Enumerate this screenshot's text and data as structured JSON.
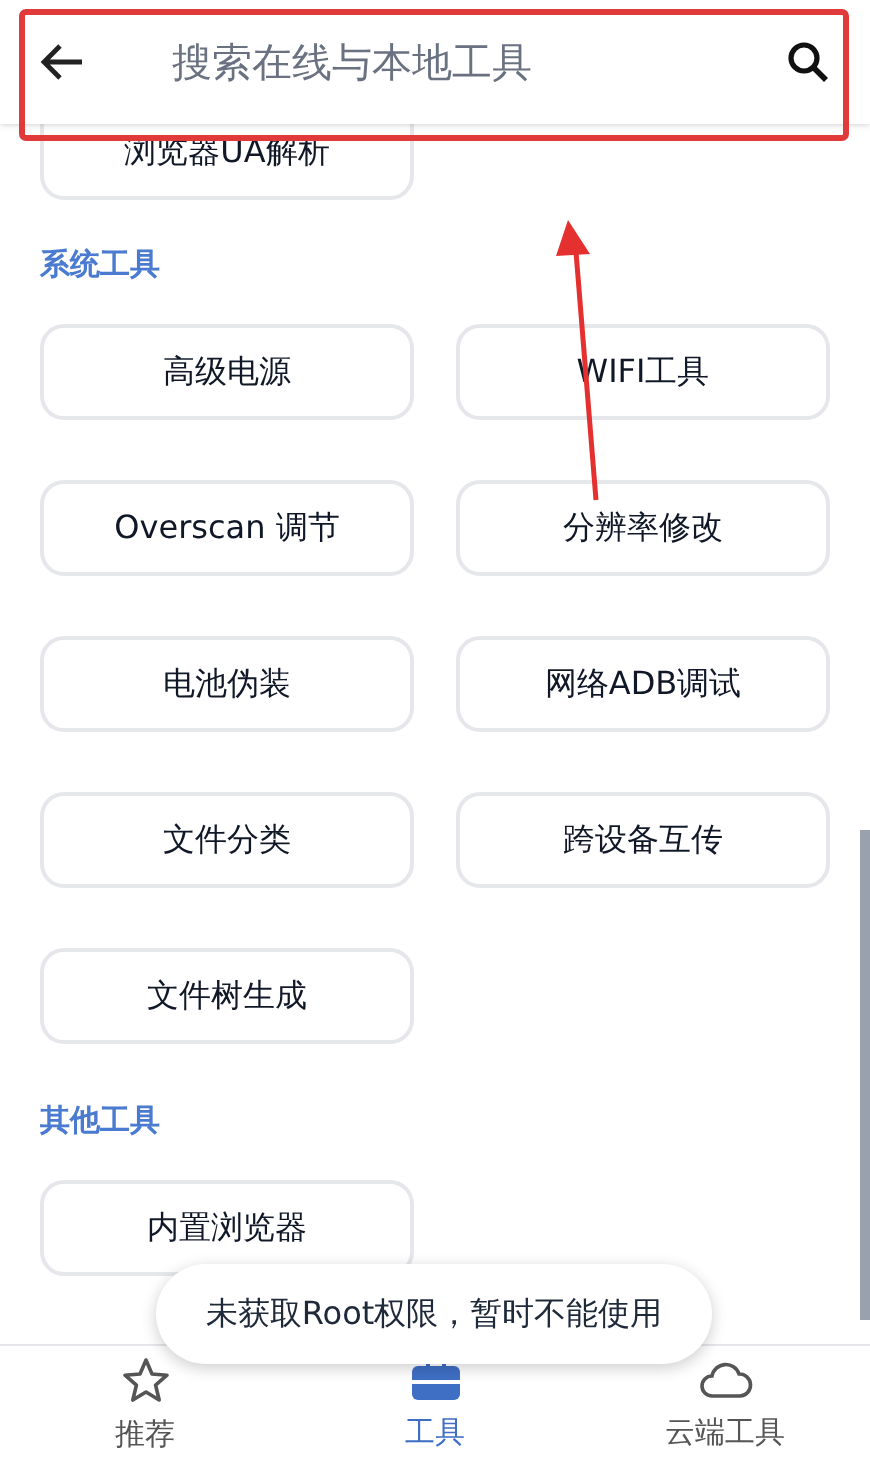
{
  "search_bar": {
    "placeholder": "搜索在线与本地工具"
  },
  "top_tools": [
    "浏览器UA解析"
  ],
  "sections": [
    {
      "title": "系统工具",
      "tools": [
        "高级电源",
        "WIFI工具",
        "Overscan 调节",
        "分辨率修改",
        "电池伪装",
        "网络ADB调试",
        "文件分类",
        "跨设备互传",
        "文件树生成"
      ]
    },
    {
      "title": "其他工具",
      "tools": [
        "内置浏览器"
      ]
    }
  ],
  "toast": "未获取Root权限，暂时不能使用",
  "bottom_nav": [
    {
      "label": "推荐",
      "kind": "star",
      "selected": false
    },
    {
      "label": "工具",
      "kind": "toolbox",
      "selected": true
    },
    {
      "label": "云端工具",
      "kind": "cloud",
      "selected": false
    }
  ]
}
